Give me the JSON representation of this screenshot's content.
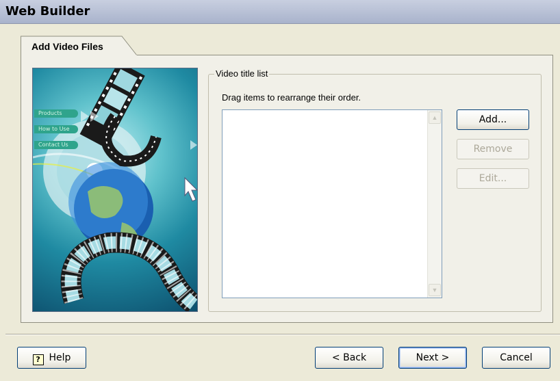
{
  "window": {
    "title": "Web Builder"
  },
  "tab": {
    "label": "Add Video Files"
  },
  "art": {
    "menu_items": [
      "Products",
      "How to Use",
      "Contact Us"
    ]
  },
  "group": {
    "legend": "Video title list",
    "hint": "Drag items to rearrange their order."
  },
  "list": {
    "items": []
  },
  "side_buttons": {
    "add": "Add...",
    "remove": "Remove",
    "edit": "Edit..."
  },
  "footer": {
    "help": "Help",
    "back": "< Back",
    "next": "Next >",
    "cancel": "Cancel"
  },
  "colors": {
    "titlebar": "#b4bdd2",
    "accent_border": "#003c74",
    "panel": "#f1f0e8"
  }
}
